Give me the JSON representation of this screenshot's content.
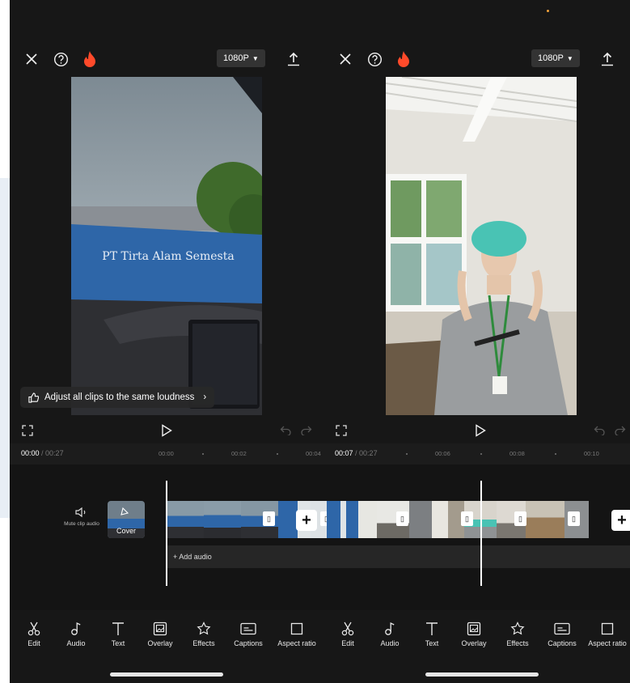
{
  "left": {
    "resolution": "1080P",
    "preview_sign": "PT Tirta Alam Semesta",
    "loudness_banner": "Adjust all clips to the same loudness",
    "time_current": "00:00",
    "time_total": "/ 00:27",
    "ticks": [
      "00:00",
      "00:02",
      "00:04"
    ],
    "mute_label": "Mute clip audio",
    "cover_label": "Cover",
    "add_audio": "+ Add audio"
  },
  "right": {
    "resolution": "1080P",
    "time_current": "00:07",
    "time_total": "/ 00:27",
    "ticks": [
      "00:06",
      "00:08",
      "00:10"
    ]
  },
  "tools": [
    "Edit",
    "Audio",
    "Text",
    "Overlay",
    "Effects",
    "Captions",
    "Aspect ratio"
  ],
  "icons": {
    "close": "close-icon",
    "help": "help-icon",
    "flame": "flame-icon",
    "export": "export-icon",
    "fullscreen": "fullscreen-icon",
    "play": "play-icon",
    "undo": "undo-icon",
    "redo": "redo-icon"
  },
  "colors": {
    "background": "#171717",
    "accent_flame": "#ff4a2a",
    "timeline": "#141414"
  }
}
